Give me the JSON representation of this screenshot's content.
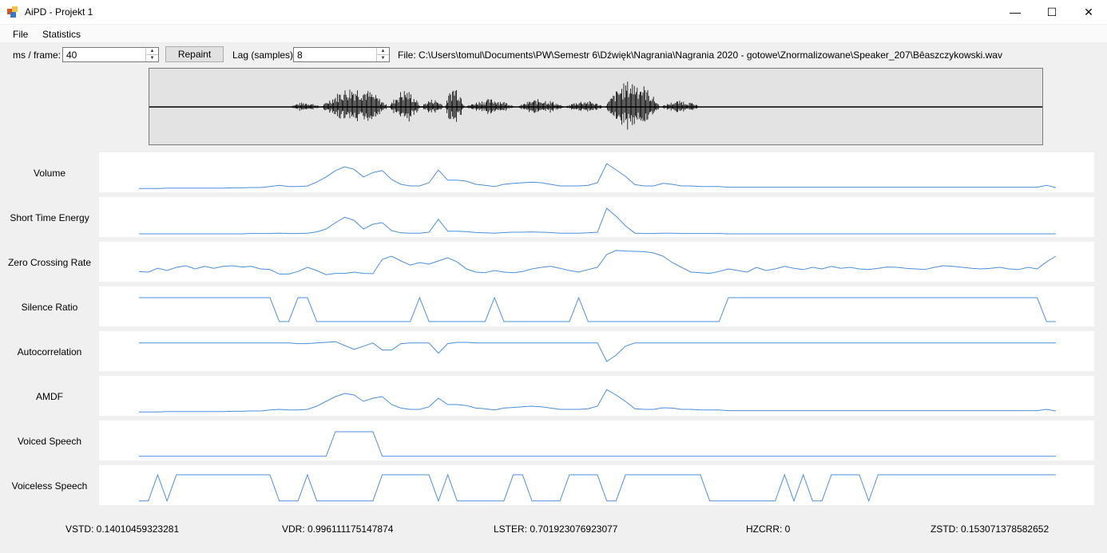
{
  "window": {
    "title": "AiPD - Projekt 1",
    "minimize": "—",
    "maximize": "☐",
    "close": "✕"
  },
  "menu": [
    "File",
    "Statistics"
  ],
  "controls": {
    "ms_frame_label": "ms / frame:",
    "ms_frame_value": "40",
    "repaint_label": "Repaint",
    "lag_label": "Lag (samples):",
    "lag_value": "8",
    "file_path": "File: C:\\Users\\tomul\\Documents\\PW\\Semestr 6\\Dźwięk\\Nagrania\\Nagrania 2020 - gotowe\\Znormalizowane\\Speaker_207\\Bêaszczykowski.wav"
  },
  "charts": [
    {
      "label": "Volume",
      "values": [
        0.02,
        0.02,
        0.02,
        0.03,
        0.03,
        0.03,
        0.03,
        0.03,
        0.03,
        0.03,
        0.04,
        0.04,
        0.05,
        0.05,
        0.08,
        0.12,
        0.08,
        0.08,
        0.1,
        0.22,
        0.38,
        0.58,
        0.7,
        0.62,
        0.38,
        0.52,
        0.58,
        0.3,
        0.15,
        0.1,
        0.1,
        0.2,
        0.6,
        0.28,
        0.28,
        0.25,
        0.15,
        0.12,
        0.08,
        0.15,
        0.18,
        0.2,
        0.22,
        0.2,
        0.15,
        0.1,
        0.1,
        0.1,
        0.12,
        0.2,
        0.8,
        0.6,
        0.4,
        0.14,
        0.1,
        0.1,
        0.18,
        0.15,
        0.1,
        0.1,
        0.08,
        0.08,
        0.08,
        0.06,
        0.06,
        0.06,
        0.06,
        0.06,
        0.06,
        0.06,
        0.06,
        0.06,
        0.06,
        0.06,
        0.06,
        0.06,
        0.06,
        0.06,
        0.06,
        0.06,
        0.06,
        0.06,
        0.06,
        0.06,
        0.06,
        0.06,
        0.06,
        0.06,
        0.06,
        0.06,
        0.06,
        0.06,
        0.06,
        0.06,
        0.06,
        0.06,
        0.06,
        0.12,
        0.05
      ]
    },
    {
      "label": "Short Time Energy",
      "values": [
        0.0,
        0.0,
        0.0,
        0.0,
        0.0,
        0.0,
        0.0,
        0.0,
        0.0,
        0.0,
        0.0,
        0.0,
        0.01,
        0.01,
        0.01,
        0.02,
        0.01,
        0.01,
        0.02,
        0.06,
        0.15,
        0.35,
        0.52,
        0.42,
        0.15,
        0.3,
        0.35,
        0.1,
        0.03,
        0.02,
        0.02,
        0.05,
        0.45,
        0.08,
        0.08,
        0.07,
        0.04,
        0.03,
        0.02,
        0.04,
        0.05,
        0.05,
        0.06,
        0.05,
        0.04,
        0.02,
        0.02,
        0.02,
        0.03,
        0.05,
        0.8,
        0.55,
        0.25,
        0.02,
        0.01,
        0.01,
        0.02,
        0.02,
        0.01,
        0.01,
        0.01,
        0.01,
        0.01,
        0.0,
        0.0,
        0.0,
        0.0,
        0.0,
        0.0,
        0.0,
        0.0,
        0.0,
        0.0,
        0.0,
        0.0,
        0.0,
        0.0,
        0.0,
        0.0,
        0.0,
        0.0,
        0.0,
        0.0,
        0.0,
        0.0,
        0.0,
        0.0,
        0.0,
        0.0,
        0.0,
        0.0,
        0.0,
        0.0,
        0.0,
        0.0,
        0.0,
        0.0,
        0.0,
        0.0
      ]
    },
    {
      "label": "Zero Crossing Rate",
      "values": [
        0.22,
        0.2,
        0.32,
        0.25,
        0.35,
        0.4,
        0.3,
        0.38,
        0.32,
        0.38,
        0.4,
        0.36,
        0.38,
        0.3,
        0.28,
        0.14,
        0.14,
        0.22,
        0.35,
        0.25,
        0.12,
        0.16,
        0.16,
        0.2,
        0.16,
        0.15,
        0.6,
        0.7,
        0.55,
        0.42,
        0.5,
        0.45,
        0.55,
        0.65,
        0.52,
        0.3,
        0.2,
        0.18,
        0.25,
        0.2,
        0.18,
        0.22,
        0.3,
        0.35,
        0.38,
        0.32,
        0.25,
        0.2,
        0.28,
        0.35,
        0.75,
        0.88,
        0.86,
        0.85,
        0.84,
        0.8,
        0.7,
        0.5,
        0.35,
        0.2,
        0.18,
        0.16,
        0.22,
        0.3,
        0.25,
        0.2,
        0.35,
        0.25,
        0.3,
        0.38,
        0.32,
        0.28,
        0.35,
        0.3,
        0.38,
        0.32,
        0.35,
        0.3,
        0.28,
        0.32,
        0.36,
        0.35,
        0.32,
        0.3,
        0.28,
        0.35,
        0.4,
        0.38,
        0.35,
        0.32,
        0.3,
        0.32,
        0.35,
        0.3,
        0.28,
        0.35,
        0.3,
        0.52,
        0.7
      ]
    },
    {
      "label": "Silence Ratio",
      "values": [
        0.8,
        0.8,
        0.8,
        0.8,
        0.8,
        0.8,
        0.8,
        0.8,
        0.8,
        0.8,
        0.8,
        0.8,
        0.8,
        0.8,
        0.8,
        0.05,
        0.05,
        0.8,
        0.8,
        0.05,
        0.05,
        0.05,
        0.05,
        0.05,
        0.05,
        0.05,
        0.05,
        0.05,
        0.05,
        0.05,
        0.8,
        0.05,
        0.05,
        0.05,
        0.05,
        0.05,
        0.05,
        0.05,
        0.8,
        0.05,
        0.05,
        0.05,
        0.05,
        0.05,
        0.05,
        0.05,
        0.05,
        0.8,
        0.05,
        0.05,
        0.05,
        0.05,
        0.05,
        0.05,
        0.05,
        0.05,
        0.05,
        0.05,
        0.05,
        0.05,
        0.05,
        0.05,
        0.05,
        0.8,
        0.8,
        0.8,
        0.8,
        0.8,
        0.8,
        0.8,
        0.8,
        0.8,
        0.8,
        0.8,
        0.8,
        0.8,
        0.8,
        0.8,
        0.8,
        0.8,
        0.8,
        0.8,
        0.8,
        0.8,
        0.8,
        0.8,
        0.8,
        0.8,
        0.8,
        0.8,
        0.8,
        0.8,
        0.8,
        0.8,
        0.8,
        0.8,
        0.8,
        0.05,
        0.05
      ]
    },
    {
      "label": "Autocorrelation",
      "values": [
        0.78,
        0.78,
        0.78,
        0.78,
        0.78,
        0.78,
        0.78,
        0.78,
        0.78,
        0.78,
        0.78,
        0.78,
        0.78,
        0.78,
        0.78,
        0.78,
        0.78,
        0.76,
        0.76,
        0.78,
        0.8,
        0.82,
        0.7,
        0.58,
        0.68,
        0.78,
        0.56,
        0.56,
        0.76,
        0.78,
        0.78,
        0.78,
        0.46,
        0.76,
        0.8,
        0.8,
        0.78,
        0.78,
        0.78,
        0.78,
        0.78,
        0.78,
        0.78,
        0.78,
        0.78,
        0.78,
        0.78,
        0.78,
        0.78,
        0.78,
        0.2,
        0.4,
        0.68,
        0.78,
        0.78,
        0.78,
        0.78,
        0.78,
        0.78,
        0.78,
        0.78,
        0.78,
        0.78,
        0.78,
        0.78,
        0.78,
        0.78,
        0.78,
        0.78,
        0.78,
        0.78,
        0.78,
        0.78,
        0.78,
        0.78,
        0.78,
        0.78,
        0.78,
        0.78,
        0.78,
        0.78,
        0.78,
        0.78,
        0.78,
        0.78,
        0.78,
        0.78,
        0.78,
        0.78,
        0.78,
        0.78,
        0.78,
        0.78,
        0.78,
        0.78,
        0.78,
        0.78,
        0.78,
        0.78
      ]
    },
    {
      "label": "AMDF",
      "values": [
        0.02,
        0.02,
        0.02,
        0.03,
        0.03,
        0.03,
        0.03,
        0.03,
        0.03,
        0.03,
        0.04,
        0.04,
        0.05,
        0.05,
        0.08,
        0.1,
        0.08,
        0.08,
        0.1,
        0.2,
        0.35,
        0.5,
        0.6,
        0.55,
        0.35,
        0.45,
        0.5,
        0.25,
        0.14,
        0.1,
        0.1,
        0.18,
        0.45,
        0.25,
        0.25,
        0.22,
        0.14,
        0.12,
        0.08,
        0.14,
        0.16,
        0.18,
        0.2,
        0.18,
        0.14,
        0.1,
        0.1,
        0.1,
        0.12,
        0.2,
        0.72,
        0.55,
        0.35,
        0.12,
        0.1,
        0.1,
        0.15,
        0.14,
        0.1,
        0.1,
        0.08,
        0.08,
        0.08,
        0.06,
        0.06,
        0.06,
        0.06,
        0.06,
        0.06,
        0.06,
        0.06,
        0.06,
        0.06,
        0.06,
        0.06,
        0.06,
        0.06,
        0.06,
        0.06,
        0.06,
        0.06,
        0.06,
        0.06,
        0.06,
        0.06,
        0.06,
        0.06,
        0.06,
        0.06,
        0.06,
        0.06,
        0.06,
        0.06,
        0.06,
        0.06,
        0.06,
        0.06,
        0.1,
        0.05
      ]
    },
    {
      "label": "Voiced Speech",
      "values": [
        0.03,
        0.03,
        0.03,
        0.03,
        0.03,
        0.03,
        0.03,
        0.03,
        0.03,
        0.03,
        0.03,
        0.03,
        0.03,
        0.03,
        0.03,
        0.03,
        0.03,
        0.03,
        0.03,
        0.03,
        0.03,
        0.8,
        0.8,
        0.8,
        0.8,
        0.8,
        0.03,
        0.03,
        0.03,
        0.03,
        0.03,
        0.03,
        0.03,
        0.03,
        0.03,
        0.03,
        0.03,
        0.03,
        0.03,
        0.03,
        0.03,
        0.03,
        0.03,
        0.03,
        0.03,
        0.03,
        0.03,
        0.03,
        0.03,
        0.03,
        0.03,
        0.03,
        0.03,
        0.03,
        0.03,
        0.03,
        0.03,
        0.03,
        0.03,
        0.03,
        0.03,
        0.03,
        0.03,
        0.03,
        0.03,
        0.03,
        0.03,
        0.03,
        0.03,
        0.03,
        0.03,
        0.03,
        0.03,
        0.03,
        0.03,
        0.03,
        0.03,
        0.03,
        0.03,
        0.03,
        0.03,
        0.03,
        0.03,
        0.03,
        0.03,
        0.03,
        0.03,
        0.03,
        0.03,
        0.03,
        0.03,
        0.03,
        0.03,
        0.03,
        0.03,
        0.03,
        0.03,
        0.03,
        0.03
      ]
    },
    {
      "label": "Voiceless Speech",
      "values": [
        0.03,
        0.03,
        0.85,
        0.03,
        0.85,
        0.85,
        0.85,
        0.85,
        0.85,
        0.85,
        0.85,
        0.85,
        0.85,
        0.85,
        0.85,
        0.03,
        0.03,
        0.03,
        0.85,
        0.03,
        0.03,
        0.03,
        0.03,
        0.03,
        0.03,
        0.03,
        0.85,
        0.85,
        0.85,
        0.85,
        0.85,
        0.85,
        0.03,
        0.85,
        0.03,
        0.03,
        0.03,
        0.03,
        0.03,
        0.03,
        0.85,
        0.85,
        0.03,
        0.03,
        0.03,
        0.03,
        0.85,
        0.85,
        0.85,
        0.85,
        0.03,
        0.03,
        0.85,
        0.85,
        0.85,
        0.85,
        0.85,
        0.85,
        0.85,
        0.85,
        0.85,
        0.03,
        0.03,
        0.03,
        0.03,
        0.03,
        0.03,
        0.03,
        0.03,
        0.85,
        0.03,
        0.85,
        0.03,
        0.03,
        0.85,
        0.85,
        0.85,
        0.85,
        0.03,
        0.85,
        0.85,
        0.85,
        0.85,
        0.85,
        0.85,
        0.85,
        0.85,
        0.85,
        0.85,
        0.85,
        0.85,
        0.85,
        0.85,
        0.85,
        0.85,
        0.85,
        0.85,
        0.85,
        0.85
      ]
    }
  ],
  "stats": {
    "vstd": "VSTD: 0.14010459323281",
    "vdr": "VDR: 0.996111175147874",
    "lster": "LSTER: 0.701923076923077",
    "hzcrr": "HZCRR: 0",
    "zstd": "ZSTD: 0.153071378582652"
  },
  "colors": {
    "plot_line": "#4a8fe0",
    "waveform": "#000000"
  }
}
